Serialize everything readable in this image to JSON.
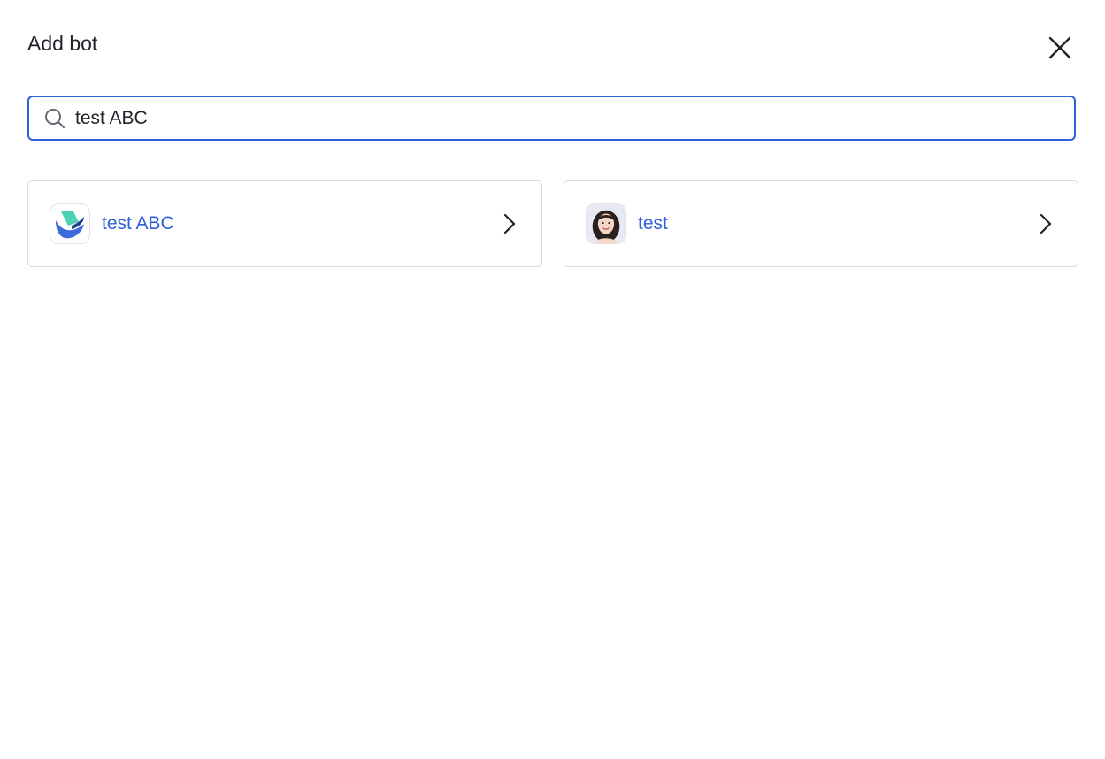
{
  "dialog": {
    "title": "Add bot",
    "close_icon": "close-icon"
  },
  "search": {
    "value": "test ABC",
    "icon": "search-icon",
    "accent_color": "#2f5fd9"
  },
  "results": [
    {
      "name": "test ABC",
      "avatar": "brand-logo-icon",
      "action_icon": "chevron-right-icon"
    },
    {
      "name": "test",
      "avatar": "user-photo-avatar",
      "action_icon": "chevron-right-icon"
    }
  ],
  "colors": {
    "link_text": "#2f5fd9",
    "card_border": "#d9dbe0"
  }
}
